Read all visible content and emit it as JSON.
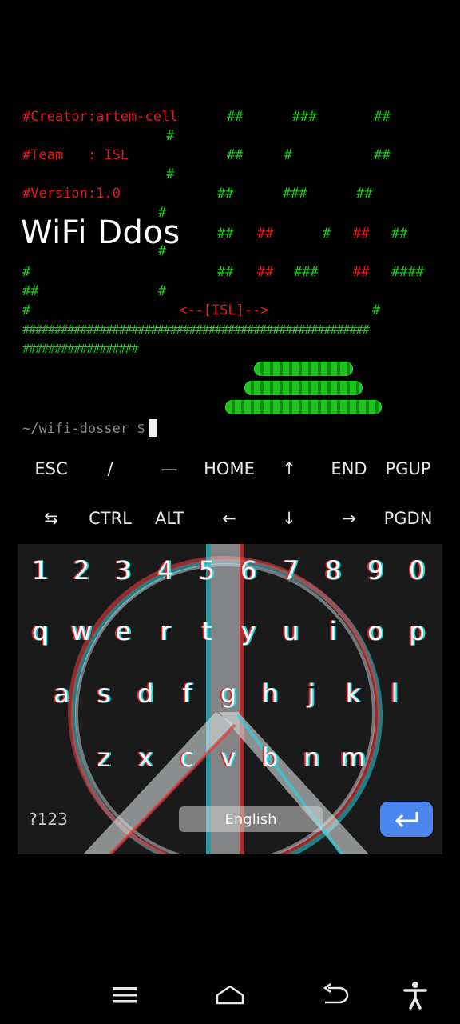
{
  "terminal": {
    "lines": [
      {
        "text": "#Creator:artem-cell",
        "color": "red"
      },
      {
        "text": "#Team   : ISL",
        "color": "red"
      },
      {
        "text": "#Version:1.0",
        "color": "red"
      }
    ],
    "art": {
      "r1": "##      ###       ##",
      "r1b": "#",
      "r2": "##     #          ##",
      "r2b": "#",
      "r3": "##      ###      ##",
      "r3b": "#",
      "r4a": "#",
      "r4b": "##",
      "r4c": "##",
      "r4d": "#",
      "r4e": "##",
      "r4f": "##",
      "r5a": "#",
      "r5b": "##",
      "r5c": "##",
      "r5d": "###",
      "r5e": "##",
      "r5f": "####",
      "r6a": "##",
      "r6b": "#",
      "r7a": "#",
      "r7b": "<--[ISL]-->",
      "r7c": "#",
      "r8": "######################################################",
      "r9": "##################"
    },
    "overlay_title": "WiFi Ddos",
    "prompt": "~/wifi-dosser $"
  },
  "extra_keys": {
    "row1": [
      "ESC",
      "/",
      "—",
      "HOME",
      "↑",
      "END",
      "PGUP"
    ],
    "row2": [
      "⇆",
      "CTRL",
      "ALT",
      "←",
      "↓",
      "→",
      "PGDN"
    ]
  },
  "keyboard": {
    "numbers": [
      "1",
      "2",
      "3",
      "4",
      "5",
      "6",
      "7",
      "8",
      "9",
      "0"
    ],
    "row_q": [
      "q",
      "w",
      "e",
      "r",
      "t",
      "y",
      "u",
      "i",
      "o",
      "p"
    ],
    "row_a": [
      "a",
      "s",
      "d",
      "f",
      "g",
      "h",
      "j",
      "k",
      "l"
    ],
    "row_z": [
      "z",
      "x",
      "c",
      "v",
      "b",
      "n",
      "m"
    ],
    "symbols_label": "?123",
    "space_label": "English",
    "colors": {
      "enter": "#4a86ee",
      "background": "#191919"
    }
  },
  "navbar": {
    "icons": [
      "menu-icon",
      "home-icon",
      "back-icon",
      "accessibility-icon"
    ]
  }
}
